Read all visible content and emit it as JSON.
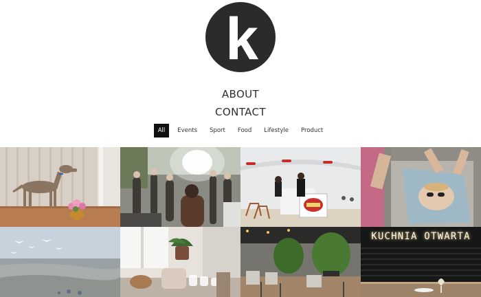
{
  "logo": {
    "letter": "k"
  },
  "nav": [
    "ABOUT",
    "CONTACT"
  ],
  "filters": [
    "All",
    "Events",
    "Sport",
    "Food",
    "Lifestyle",
    "Product"
  ],
  "active_filter": "All",
  "gallery": [
    {
      "name": "dog-photo"
    },
    {
      "name": "event-crowd-photo"
    },
    {
      "name": "beach-bar-photo"
    },
    {
      "name": "beach-towel-photo"
    },
    {
      "name": "seaside-birds-photo"
    },
    {
      "name": "interior-cafe-photo"
    },
    {
      "name": "restaurant-plants-photo"
    },
    {
      "name": "kuchnia-otwarta-photo",
      "neon_text": "KUCHNIA OTWARTA"
    }
  ]
}
